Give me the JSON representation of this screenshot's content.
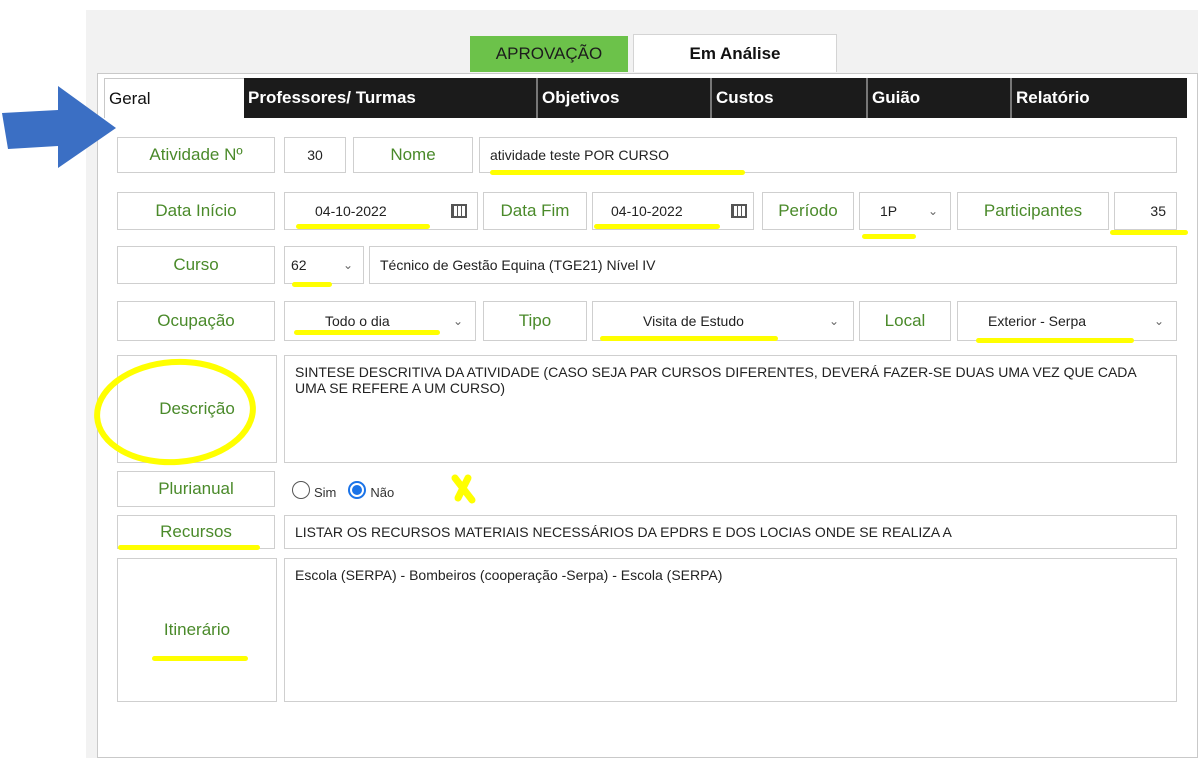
{
  "status": {
    "approval": "APROVAÇÃO",
    "state": "Em Análise"
  },
  "tabs": [
    "Geral",
    "Professores/ Turmas",
    "Objetivos",
    "Custos",
    "Guião",
    "Relatório"
  ],
  "form": {
    "atividade_label": "Atividade Nº",
    "atividade_value": "30",
    "nome_label": "Nome",
    "nome_value": "atividade teste POR CURSO",
    "data_inicio_label": "Data Início",
    "data_inicio_value": "04-10-2022",
    "data_fim_label": "Data Fim",
    "data_fim_value": "04-10-2022",
    "periodo_label": "Período",
    "periodo_value": "1P",
    "participantes_label": "Participantes",
    "participantes_value": "35",
    "curso_label": "Curso",
    "curso_value": "62",
    "curso_desc": "Técnico de Gestão Equina (TGE21) Nível IV",
    "ocupacao_label": "Ocupação",
    "ocupacao_value": "Todo o dia",
    "tipo_label": "Tipo",
    "tipo_value": "Visita de Estudo",
    "local_label": "Local",
    "local_value": "Exterior - Serpa",
    "descricao_label": "Descrição",
    "descricao_value": "SINTESE DESCRITIVA DA ATIVIDADE (CASO SEJA PAR CURSOS DIFERENTES, DEVERÁ FAZER-SE DUAS UMA VEZ QUE CADA UMA SE REFERE A UM CURSO)",
    "plurianual_label": "Plurianual",
    "opt_sim": "Sim",
    "opt_nao": "Não",
    "plurianual_selected": "Não",
    "recursos_label": "Recursos",
    "recursos_value": "LISTAR OS RECURSOS MATERIAIS NECESSÁRIOS DA EPDRS E DOS  LOCIAS ONDE SE REALIZA A",
    "itinerario_label": "Itinerário",
    "itinerario_value": "Escola (SERPA) - Bombeiros (cooperação -Serpa) - Escola (SERPA)"
  },
  "icons": {
    "dropdown": "chevron-down-icon",
    "calendar": "calendar-icon"
  },
  "colors": {
    "approval": "#6cc24a",
    "label_text": "#4a8a2a",
    "tab_bg": "#1b1b1b",
    "highlight": "#ffff00",
    "arrow": "#3b6fc4",
    "radio": "#1a73e8"
  }
}
